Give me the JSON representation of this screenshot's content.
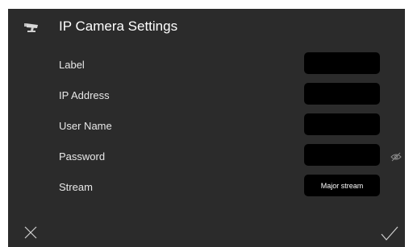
{
  "header": {
    "title": "IP Camera Settings",
    "icon": "camera-icon"
  },
  "form": {
    "label": {
      "label": "Label",
      "value": "",
      "placeholder": ""
    },
    "ip_address": {
      "label": "IP Address",
      "value": "",
      "placeholder": ""
    },
    "user_name": {
      "label": "User Name",
      "value": "",
      "placeholder": ""
    },
    "password": {
      "label": "Password",
      "value": "",
      "placeholder": "",
      "toggle_icon": "eye-slash-icon"
    },
    "stream": {
      "label": "Stream",
      "selected": "Major stream"
    }
  },
  "footer": {
    "cancel_icon": "close-icon",
    "confirm_icon": "check-icon"
  },
  "colors": {
    "background": "#2b2b2b",
    "field_background": "#000000",
    "text": "#ffffff"
  }
}
